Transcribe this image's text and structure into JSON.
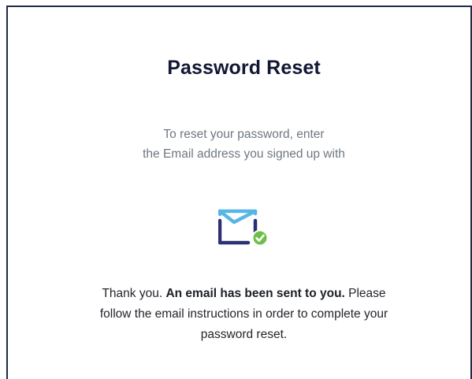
{
  "page": {
    "title": "Password Reset",
    "instructions": {
      "line1": "To reset your password, enter",
      "line2": "the Email address you signed up with"
    },
    "status_icon": "email-sent-check-icon",
    "message": {
      "prefix": "Thank you. ",
      "bold": "An email has been sent to you.",
      "suffix": " Please",
      "line2": "follow the email instructions in order to complete your",
      "line3": "password reset."
    }
  },
  "colors": {
    "border": "#1f2a44",
    "title": "#121733",
    "subtitle": "#6e7781",
    "envelope_light": "#57b6e6",
    "envelope_dark": "#2d2f74",
    "check": "#6cc04a"
  }
}
